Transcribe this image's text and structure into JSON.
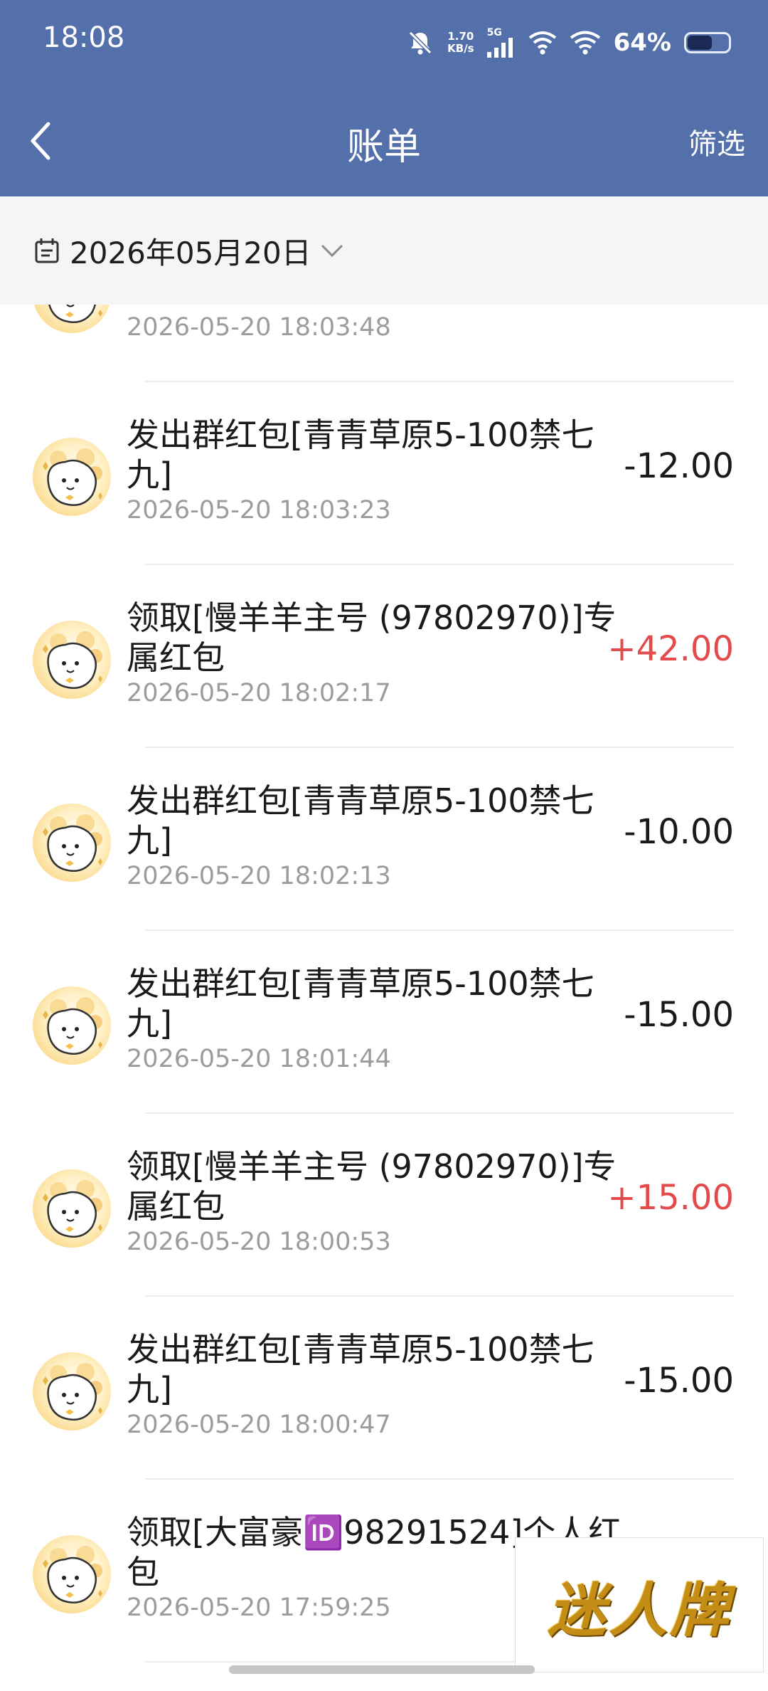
{
  "status_bar": {
    "time": "18:08",
    "net_speed_value": "1.70",
    "net_speed_unit": "KB/s",
    "network_type": "5G",
    "battery_percent": "64%",
    "battery_level": 0.64
  },
  "header": {
    "title": "账单",
    "filter_label": "筛选"
  },
  "date_filter": {
    "label": "2026年05月20日"
  },
  "transactions": [
    {
      "title": "九]",
      "time": "2026-05-20 18:03:48",
      "amount": ""
    },
    {
      "title": "发出群红包[青青草原5-100禁七九]",
      "time": "2026-05-20 18:03:23",
      "amount": "-12.00"
    },
    {
      "title": "领取[慢羊羊主号 (97802970)]专属红包",
      "time": "2026-05-20 18:02:17",
      "amount": "+42.00"
    },
    {
      "title": "发出群红包[青青草原5-100禁七九]",
      "time": "2026-05-20 18:02:13",
      "amount": "-10.00"
    },
    {
      "title": "发出群红包[青青草原5-100禁七九]",
      "time": "2026-05-20 18:01:44",
      "amount": "-15.00"
    },
    {
      "title": "领取[慢羊羊主号 (97802970)]专属红包",
      "time": "2026-05-20 18:00:53",
      "amount": "+15.00"
    },
    {
      "title": "发出群红包[青青草原5-100禁七九]",
      "time": "2026-05-20 18:00:47",
      "amount": "-15.00"
    },
    {
      "title": "领取[大富豪🆔98291524]个人红包",
      "time": "2026-05-20 17:59:25",
      "amount": ""
    }
  ],
  "watermark": {
    "text": "迷人牌"
  },
  "colors": {
    "header_bg": "#5470ab",
    "positive_amount": "#e34a4a",
    "negative_amount": "#1a1a1a",
    "timestamp": "#9c9c9c"
  }
}
